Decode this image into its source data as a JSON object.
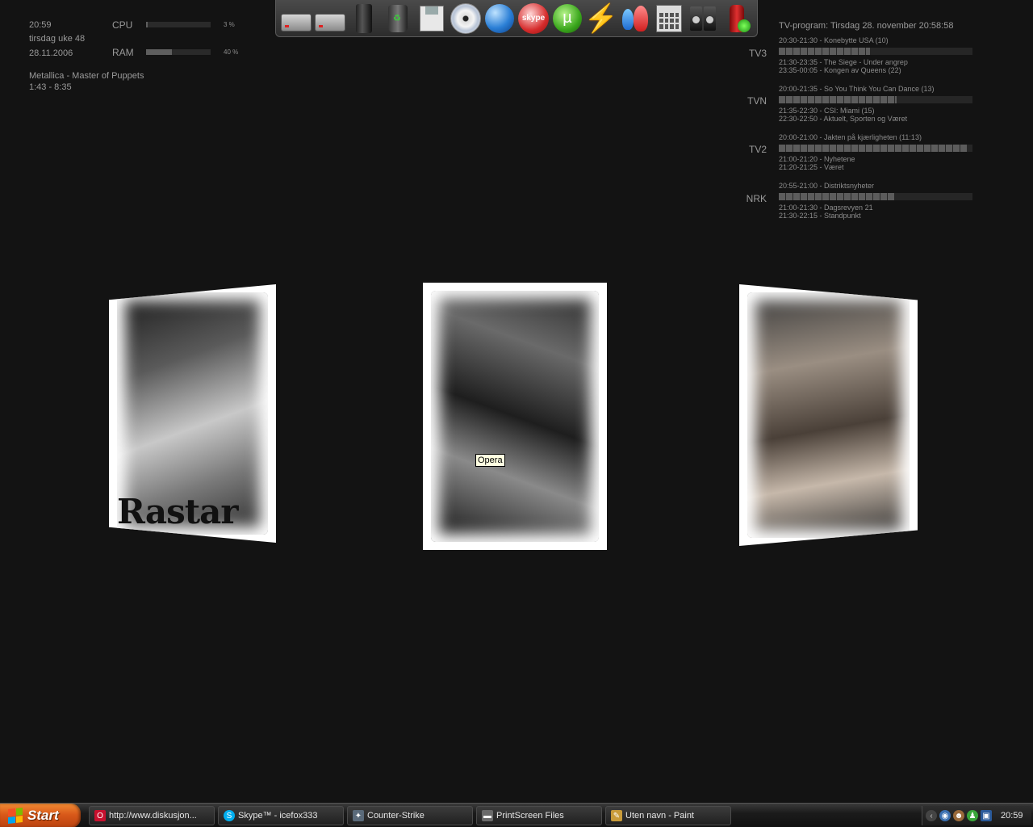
{
  "system": {
    "time": "20:59",
    "week": "tirsdag uke 48",
    "date": "28.11.2006",
    "now_playing": "Metallica - Master of Puppets",
    "track_position": "1:43 - 8:35",
    "cpu": {
      "label": "CPU",
      "percent_text": "3 %",
      "value": 0.03
    },
    "ram": {
      "label": "RAM",
      "percent_text": "40 %",
      "value": 0.4
    }
  },
  "dock": {
    "icons": [
      "hard-drive-icon",
      "hard-drive-icon",
      "ipod-icon",
      "recycle-bin-icon",
      "floppy-disk-icon",
      "cd-drive-icon",
      "globe-icon",
      "skype-icon",
      "utorrent-icon",
      "lightning-icon",
      "msn-contacts-icon",
      "calculator-icon",
      "speakers-icon",
      "fire-extinguisher-icon"
    ],
    "skype_label": "skype",
    "utorrent_label": "µ"
  },
  "tv": {
    "header": "TV-program: Tirsdag 28. november 20:58:58",
    "channels": [
      {
        "name": "TV3",
        "now": "20:30-21:30 - Konebytte USA (10)",
        "progress": 0.47,
        "next1": "21:30-23:35 - The Siege - Under angrep",
        "next2": "23:35-00:05 - Kongen av Queens (22)"
      },
      {
        "name": "TVN",
        "now": "20:00-21:35 - So You Think You Can Dance (13)",
        "progress": 0.61,
        "next1": "21:35-22:30 - CSI: Miami (15)",
        "next2": "22:30-22:50 - Aktuelt, Sporten og Været"
      },
      {
        "name": "TV2",
        "now": "20:00-21:00 - Jakten på kjærligheten (11:13)",
        "progress": 0.97,
        "next1": "21:00-21:20 - Nyhetene",
        "next2": "21:20-21:25 - Været"
      },
      {
        "name": "NRK",
        "now": "20:55-21:00 - Distriktsnyheter",
        "progress": 0.6,
        "next1": "21:00-21:30 - Dagsrevyen 21",
        "next2": "21:30-22:15 - Standpunkt"
      }
    ]
  },
  "photos": {
    "left_caption": "Rastar"
  },
  "tooltip": "Opera",
  "taskbar": {
    "start_label": "Start",
    "tasks": [
      {
        "label": "http://www.diskusjon...",
        "icon": "opera-icon",
        "color": "#c8102e"
      },
      {
        "label": "Skype™ - icefox333",
        "icon": "skype-icon",
        "color": "#00aff0"
      },
      {
        "label": "Counter-Strike",
        "icon": "counter-strike-icon",
        "color": "#5a6a7a"
      },
      {
        "label": "PrintScreen Files",
        "icon": "folder-icon",
        "color": "#6a6a6a"
      },
      {
        "label": "Uten navn - Paint",
        "icon": "paint-icon",
        "color": "#c89b3a"
      }
    ],
    "tray_icons": [
      "chevron-left-icon",
      "network-globe-icon",
      "monkey-icon",
      "msn-icon",
      "connection-icon"
    ],
    "clock": "20:59"
  }
}
